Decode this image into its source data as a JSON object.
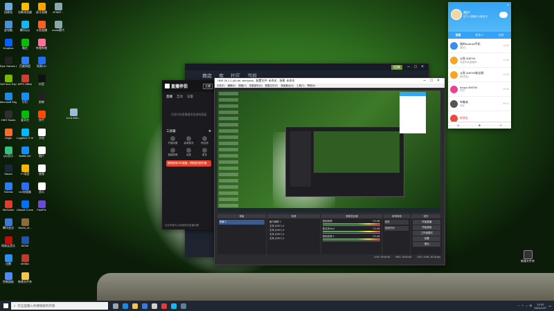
{
  "desktop": {
    "col1": [
      {
        "label": "回收站",
        "color": "#6fa8dc"
      },
      {
        "label": "此电脑",
        "color": "#4a90d9"
      },
      {
        "label": "Dropbox",
        "color": "#0061fe"
      },
      {
        "label": "Epic Games Launcher",
        "color": "#222222"
      },
      {
        "label": "GeForce Experience",
        "color": "#76b900"
      },
      {
        "label": "Microsoft Edge",
        "color": "#1e88e5"
      },
      {
        "label": "OBS Studio",
        "color": "#302e31"
      },
      {
        "label": "Origin",
        "color": "#f56c2d"
      },
      {
        "label": "QQ音乐",
        "color": "#31c27c"
      },
      {
        "label": "Steam",
        "color": "#1b2838"
      },
      {
        "label": "ToDesk",
        "color": "#2a7ef4"
      },
      {
        "label": "WeGame",
        "color": "#e33b2e"
      },
      {
        "label": "腾讯会议",
        "color": "#3a7bd5"
      },
      {
        "label": "网易云音乐",
        "color": "#c20c0c"
      },
      {
        "label": "迅雷",
        "color": "#2b8ef0"
      },
      {
        "label": "控制面板",
        "color": "#4c8bf5"
      }
    ],
    "col2": [
      {
        "label": "谷歌浏览器",
        "color": "#fbbc05"
      },
      {
        "label": "腾讯QQ",
        "color": "#12b7f5"
      },
      {
        "label": "微信",
        "color": "#09bb07"
      },
      {
        "label": "百度网盘",
        "color": "#2f7bf6"
      },
      {
        "label": "WPS Office",
        "color": "#d63a3a"
      },
      {
        "label": "钉钉",
        "color": "#1a8cff"
      },
      {
        "label": "爱奇艺",
        "color": "#00be06"
      },
      {
        "label": "Logitech G HUB",
        "color": "#00b8fc"
      },
      {
        "label": "Battle.net",
        "color": "#148eff"
      },
      {
        "label": "YY语音",
        "color": "#f7b500"
      },
      {
        "label": "UU加速器",
        "color": "#2c6cf6"
      },
      {
        "label": "Ubisoft Connect",
        "color": "#0070ff"
      },
      {
        "label": "World_of...",
        "color": "#8b6b3a"
      },
      {
        "label": "WOW",
        "color": "#2255aa"
      },
      {
        "label": "MOBA",
        "color": "#c0392b"
      },
      {
        "label": "新建文件夹",
        "color": "#f3c54d"
      }
    ],
    "col3": [
      {
        "label": "虎牙直播",
        "color": "#ffa200"
      },
      {
        "label": "斗鱼直播",
        "color": "#ff5d23"
      },
      {
        "label": "哔哩哔哩",
        "color": "#fb7299"
      },
      {
        "label": "网易UU",
        "color": "#1d6ef2"
      },
      {
        "label": "抖音",
        "color": "#111111"
      },
      {
        "label": "剪映",
        "color": "#222222"
      },
      {
        "label": "快手",
        "color": "#ff4906"
      },
      {
        "label": "文档",
        "color": "#ffffff"
      },
      {
        "label": "图片",
        "color": "#ffffff"
      },
      {
        "label": "视频",
        "color": "#ffffff"
      },
      {
        "label": "音乐",
        "color": "#ffffff"
      },
      {
        "label": "FastPic",
        "color": "#6a4bd6"
      }
    ],
    "col4": [
      {
        "label": "ATM6T..."
      },
      {
        "label": "mods替代"
      }
    ],
    "floating_icon": {
      "label": "b-bd-4fcb..."
    },
    "right_icon": {
      "label": "新建文件夹"
    }
  },
  "back_window": {
    "tabs": [
      "商店",
      "库",
      "社区",
      "当前"
    ],
    "rightbtn": "切换"
  },
  "zhibo_app": {
    "logo": "直播伴侣",
    "badge": "主播",
    "tabs": [
      "直播",
      "互动",
      "设置"
    ],
    "hint": "已经开启直播请添加游戏画面",
    "section": "工具箱",
    "tools": [
      "开播设置",
      "高清推流",
      "粉丝团",
      "直播录像",
      "连麦",
      "更多"
    ],
    "banner": "推荐使用OBS直播，获取推流码开播",
    "footer": "在此界面可以快速修改直播标题"
  },
  "obs": {
    "title": "OBS 26.1.1 (64-bit, windows) - 配置文件: 未命名 - 场景: 未命名",
    "menu": [
      "文件(F)",
      "编辑(E)",
      "视图(V)",
      "停靠部件(D)",
      "配置文件(P)",
      "场景集合(S)",
      "工具(T)",
      "帮助(H)"
    ],
    "panel_headers": [
      "场景",
      "来源",
      "音频混合器",
      "转场特效",
      "控件"
    ],
    "scenes": [
      "场景 2"
    ],
    "sources": [
      "窗口捕获 1",
      "文本 (GDI+) 4",
      "文本 (GDI+) 3",
      "文本 (GDI+) 2",
      "文本 (GDI+) 1"
    ],
    "mixer": [
      {
        "name": "桌面音频",
        "db": "0.0 dB"
      },
      {
        "name": "麦克风/Aux",
        "db": "0.0 dB"
      },
      {
        "name": "桌面音频 2",
        "db": "0.0 dB"
      }
    ],
    "transition_buttons": [
      "渐变",
      "持续时间"
    ],
    "controls": [
      "开始直播",
      "开始录制",
      "工作室模式",
      "设置",
      "退出"
    ],
    "status": [
      "LIVE: 00:00:00",
      "REC: 00:00:00",
      "CPU: 3.5%, 30.00 fps"
    ]
  },
  "qq": {
    "name": "用户",
    "status": "这个人很懒什么都没写",
    "tabs": [
      "消息",
      "联系人",
      "空间"
    ],
    "messages": [
      {
        "name": "我的Android手机",
        "msg": "[图片]",
        "time": "12:05",
        "color": "#3a8de8"
      },
      {
        "name": "斗鱼 308704",
        "msg": "欢迎来到直播间",
        "time": "11:56",
        "color": "#f5a623"
      },
      {
        "name": "斗鱼 308704粉丝群",
        "msg": "[群消息]",
        "time": "11:30",
        "color": "#f5a623"
      },
      {
        "name": "douyu 308704",
        "msg": "好的",
        "time": "10:48",
        "color": "#e84393"
      },
      {
        "name": "布鲁弟",
        "msg": "你好",
        "time": "09:12",
        "color": "#555555"
      },
      {
        "name": "新朋友",
        "msg": "",
        "time": "",
        "color": "#e74c3c"
      }
    ],
    "new_label": "新朋友"
  },
  "taskbar": {
    "search_placeholder": "在这里输入你要搜索的内容",
    "apps": [
      {
        "name": "task-view",
        "color": "#9aa4b1"
      },
      {
        "name": "edge",
        "color": "#1e88e5"
      },
      {
        "name": "explorer",
        "color": "#f3c54d"
      },
      {
        "name": "store",
        "color": "#3a7bd5"
      },
      {
        "name": "obs",
        "color": "#d0d0d0"
      },
      {
        "name": "zhibo",
        "color": "#e23b3b"
      },
      {
        "name": "qq",
        "color": "#12b7f5"
      },
      {
        "name": "steam",
        "color": "#5f7e9c"
      }
    ],
    "time": "13:20",
    "date": "2021/1/27",
    "lang": "中"
  }
}
